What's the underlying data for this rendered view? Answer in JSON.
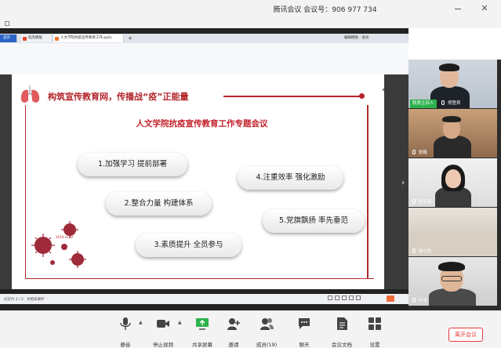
{
  "window": {
    "title": "腾讯会议  会议号：906 977 734"
  },
  "browser": {
    "tabs": [
      {
        "label": "首页"
      },
      {
        "label": "稻壳模板"
      },
      {
        "label": "人文学院抗疫宣传教育工作.pptx"
      },
      {
        "label": "+"
      }
    ],
    "right_tab": "编辑模板 - 会员"
  },
  "slide": {
    "heading": "构筑宣传教育网，传播战“疫”正能量",
    "subtitle": "人文学院抗疫宣传教育工作专题会议",
    "items": [
      "1.加强学习  提前部署",
      "2.整合力量  构建体系",
      "3.素质提升  全员参与",
      "4.注重效率  强化激励",
      "5.党旗飘扬  率先垂范"
    ],
    "virus_label": "2019-nCoV"
  },
  "status_bar": {
    "slide_count": "幻灯片 2 / 2",
    "protect_status": "文档未保护"
  },
  "participants": [
    {
      "name": "郑登宾",
      "host_badge": "联席主持人"
    },
    {
      "name": "张巍"
    },
    {
      "name": "张玉清"
    },
    {
      "name": "谢心怡"
    },
    {
      "name": "叶杰"
    }
  ],
  "controls": {
    "mute": "静音",
    "stop_video": "停止视频",
    "share_screen": "共享屏幕",
    "invite": "邀请",
    "members": "成员(19)",
    "chat": "聊天",
    "meeting_docs": "会议文档",
    "settings": "设置",
    "leave": "离开会议"
  },
  "colors": {
    "accent_red": "#b3262b",
    "host_green": "#2bb24c",
    "leave_red": "#e6393e"
  }
}
